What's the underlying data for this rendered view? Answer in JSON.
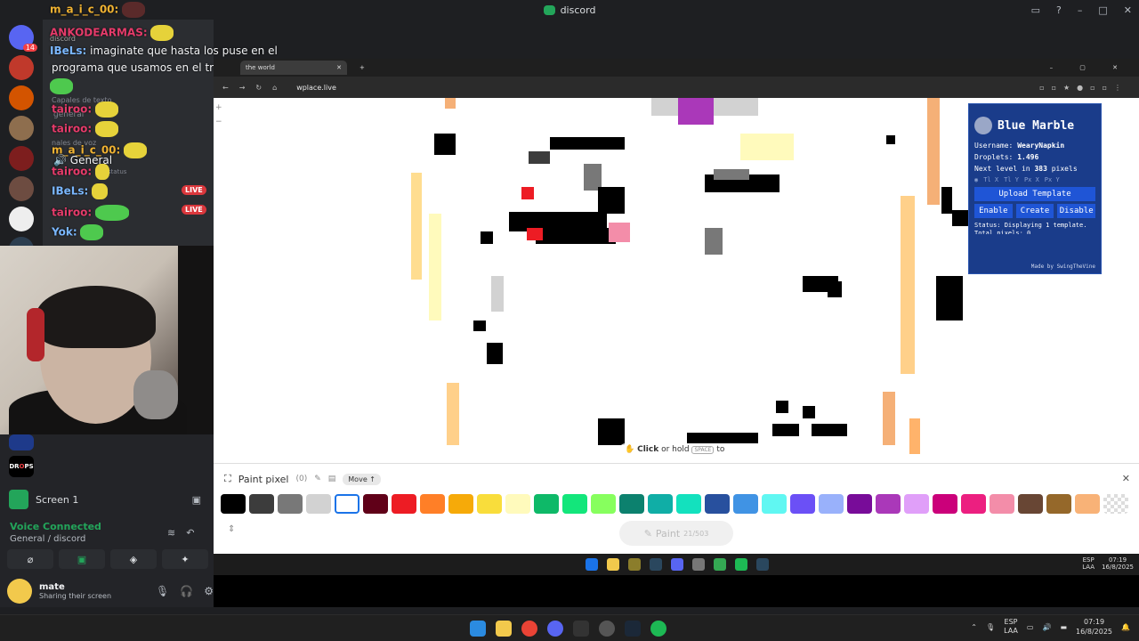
{
  "window": {
    "title": "discord"
  },
  "servers": {
    "badge_count": "14"
  },
  "chat": {
    "line1_name": "m_a_i_c_00:",
    "line2_name": "ANKODEARMAS:",
    "line2_prefix": "discord",
    "line3_name": "IBeLs:",
    "line3_text": "imaginate que hasta los puse en el",
    "line4_text": "programa que usamos en el trabajo para hablar",
    "line5_name": "tairoo:",
    "line6_name": "tairoo:",
    "line7_name": "m_a_i_c_00:",
    "channel_general": "General",
    "line8_name": "tairoo:",
    "line9_name": "IBeLs:",
    "line10_name": "tairoo:",
    "line11_name": "Yok:",
    "live_label": "LIVE",
    "bg_cat1": "Capales de texto",
    "bg_general": "general",
    "bg_cat2": "nales de voz",
    "bg_status": "nel status"
  },
  "voice": {
    "screen_label": "Screen 1",
    "connected": "Voice Connected",
    "channel": "General / discord"
  },
  "user": {
    "name": "mate",
    "status": "Sharing their screen"
  },
  "browser": {
    "tab_title": "the world",
    "url": "wplace.live"
  },
  "blue_marble": {
    "title": "Blue Marble",
    "username_label": "Username:",
    "username": "WearyNapkin",
    "droplets_label": "Droplets:",
    "droplets": "1.496",
    "nextlevel_prefix": "Next level in",
    "nextlevel_value": "383",
    "nextlevel_suffix": "pixels",
    "coord_labels": [
      "Tl X",
      "Tl Y",
      "Px X",
      "Px Y"
    ],
    "upload": "Upload Template",
    "enable": "Enable",
    "create": "Create",
    "disable": "Disable",
    "status": "Status: Displaying 1 template.",
    "total": "Total pixels: 0",
    "credit": "Made by SwingTheVine"
  },
  "paint": {
    "title": "Paint pixel",
    "count": "(0)",
    "move": "Move",
    "button": "Paint",
    "button_sub": "21/503",
    "hint_click": "Click",
    "hint_or": "or hold",
    "hint_key": "SPACE",
    "hint_to": "to",
    "colors": [
      "#000000",
      "#3c3c3c",
      "#787878",
      "#d2d2d2",
      "#ffffff",
      "#600018",
      "#ed1c24",
      "#ff7f27",
      "#f6aa09",
      "#f9dd3b",
      "#fffabc",
      "#0eb968",
      "#13e67b",
      "#87ff5e",
      "#0c816e",
      "#10aea6",
      "#13e1be",
      "#28509e",
      "#4093e4",
      "#60f7f2",
      "#6b50f6",
      "#99b1fb",
      "#780c99",
      "#aa38b9",
      "#e09ff9",
      "#cb007a",
      "#ec1f80",
      "#f38da9",
      "#684634",
      "#95682a",
      "#f8b277",
      "#e5e5e5"
    ],
    "selected_index": 4
  },
  "inner_taskbar": {
    "lang": "ESP",
    "lang2": "LAA",
    "time": "07:19",
    "date": "16/8/2025"
  },
  "taskbar": {
    "lang": "ESP",
    "lang2": "LAA",
    "time": "07:19",
    "date": "16/8/2025"
  }
}
